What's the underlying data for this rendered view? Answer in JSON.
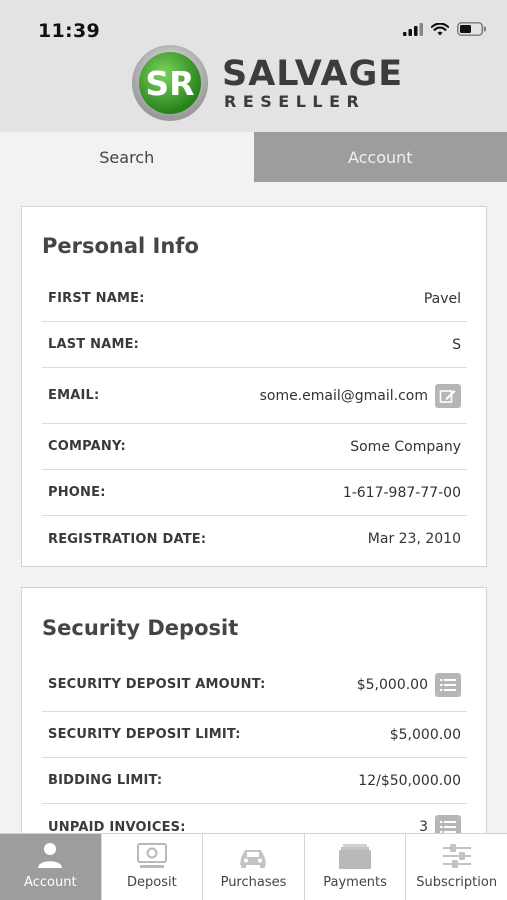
{
  "status": {
    "time": "11:39"
  },
  "brand": {
    "line1": "SALVAGE",
    "line2": "RESELLER",
    "logo_letters": "SR"
  },
  "tabs": [
    {
      "label": "Search",
      "active": false
    },
    {
      "label": "Account",
      "active": true
    }
  ],
  "personal_info": {
    "title": "Personal Info",
    "rows": [
      {
        "label": "FIRST NAME:",
        "value": "Pavel"
      },
      {
        "label": "LAST NAME:",
        "value": "S"
      },
      {
        "label": "EMAIL:",
        "value": "some.email@gmail.com",
        "icon": "edit-icon"
      },
      {
        "label": "COMPANY:",
        "value": "Some Company"
      },
      {
        "label": "PHONE:",
        "value": "1-617-987-77-00"
      },
      {
        "label": "REGISTRATION DATE:",
        "value": "Mar 23, 2010"
      }
    ]
  },
  "security_deposit": {
    "title": "Security Deposit",
    "rows": [
      {
        "label": "SECURITY DEPOSIT AMOUNT:",
        "value": "$5,000.00",
        "icon": "list-icon"
      },
      {
        "label": "SECURITY DEPOSIT LIMIT:",
        "value": "$5,000.00"
      },
      {
        "label": "BIDDING LIMIT:",
        "value": "12/$50,000.00"
      },
      {
        "label": "UNPAID INVOICES:",
        "value": "3",
        "icon": "list-icon"
      }
    ]
  },
  "bottom_nav": [
    {
      "label": "Account",
      "icon": "person-icon",
      "active": true
    },
    {
      "label": "Deposit",
      "icon": "cash-icon",
      "active": false
    },
    {
      "label": "Purchases",
      "icon": "car-icon",
      "active": false
    },
    {
      "label": "Payments",
      "icon": "wallet-icon",
      "active": false
    },
    {
      "label": "Subscription",
      "icon": "sliders-icon",
      "active": false
    }
  ],
  "colors": {
    "active_gray": "#9d9d9d",
    "logo_green": "#3a9a2a",
    "background": "#f2f2f2"
  }
}
